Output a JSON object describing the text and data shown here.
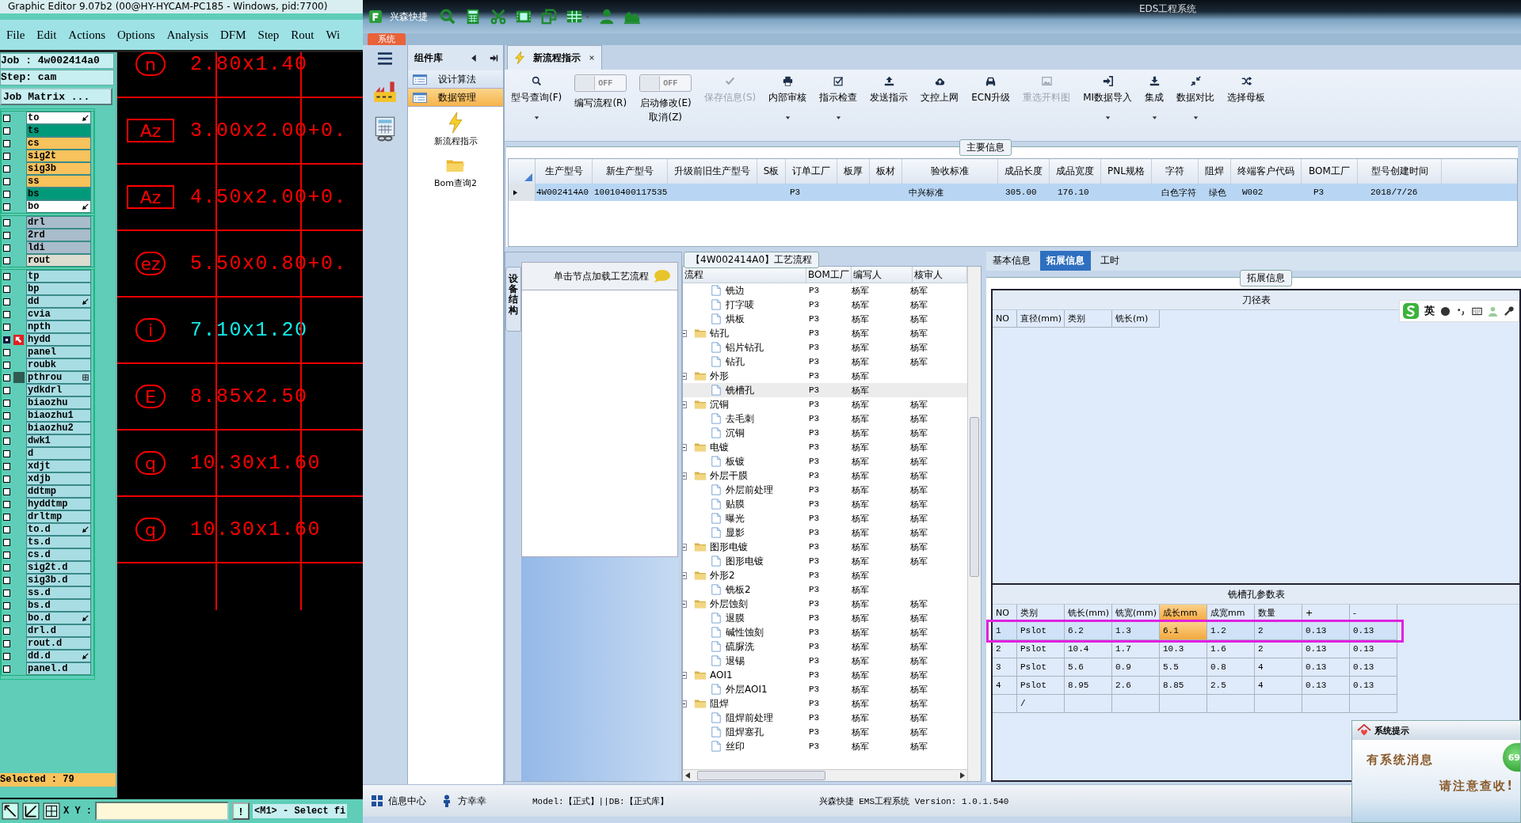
{
  "editor": {
    "title": "Graphic Editor 9.07b2 (00@HY-HYCAM-PC185 - Windows, pid:7700)",
    "menu": [
      "File",
      "Edit",
      "Actions",
      "Options",
      "Analysis",
      "DFM",
      "Step",
      "Rout",
      "Wi"
    ],
    "job": "Job : 4w002414a0",
    "step": "Step: cam",
    "matrix_button": "Job Matrix ...",
    "layer_groups": [
      [
        {
          "name": "to",
          "color": "#ffffff",
          "kind": "arrow",
          "checked": false
        },
        {
          "name": "ts",
          "color": "#009a7a",
          "kind": "plain",
          "checked": false
        },
        {
          "name": "cs",
          "color": "#f8c25c",
          "kind": "plain",
          "checked": false
        },
        {
          "name": "sig2t",
          "color": "#f8c25c",
          "kind": "plain",
          "checked": false
        },
        {
          "name": "sig3b",
          "color": "#f8c25c",
          "kind": "plain",
          "checked": false
        },
        {
          "name": "ss",
          "color": "#f8c25c",
          "kind": "plain",
          "checked": false
        },
        {
          "name": "bs",
          "color": "#009a7a",
          "kind": "plain",
          "checked": false
        },
        {
          "name": "bo",
          "color": "#ffffff",
          "kind": "arrow",
          "checked": false
        }
      ],
      [
        {
          "name": "drl",
          "color": "#a9bccb",
          "kind": "plain",
          "checked": false
        },
        {
          "name": "2rd",
          "color": "#a9bccb",
          "kind": "plain",
          "checked": false
        },
        {
          "name": "ldi",
          "color": "#a9bccb",
          "kind": "plain",
          "checked": false
        },
        {
          "name": "rout",
          "color": "#dcdccf",
          "kind": "plain",
          "checked": false
        }
      ],
      [
        {
          "name": "tp",
          "color": "#a8dde3",
          "kind": "plain",
          "checked": false
        },
        {
          "name": "bp",
          "color": "#a8dde3",
          "kind": "plain",
          "checked": false
        },
        {
          "name": "dd",
          "color": "#a8dde3",
          "kind": "arrow",
          "checked": false
        },
        {
          "name": "cvia",
          "color": "#a8dde3",
          "kind": "plain",
          "checked": false
        },
        {
          "name": "npth",
          "color": "#a8dde3",
          "kind": "plain",
          "checked": false
        },
        {
          "name": "hydd",
          "color": "#a8dde3",
          "kind": "work",
          "checked": true
        },
        {
          "name": "panel",
          "color": "#a8dde3",
          "kind": "plain",
          "checked": false
        },
        {
          "name": "roubk",
          "color": "#a8dde3",
          "kind": "plain",
          "checked": false
        },
        {
          "name": "pthrou",
          "color": "#a8dde3",
          "kind": "grid",
          "checked": false
        },
        {
          "name": "ydkdrl",
          "color": "#a8dde3",
          "kind": "plain",
          "checked": false
        },
        {
          "name": "biaozhu",
          "color": "#a8dde3",
          "kind": "plain",
          "checked": false
        },
        {
          "name": "biaozhu1",
          "color": "#a8dde3",
          "kind": "plain",
          "checked": false
        },
        {
          "name": "biaozhu2",
          "color": "#a8dde3",
          "kind": "plain",
          "checked": false
        },
        {
          "name": "dwk1",
          "color": "#a8dde3",
          "kind": "plain",
          "checked": false
        },
        {
          "name": "d",
          "color": "#a8dde3",
          "kind": "plain",
          "checked": false
        },
        {
          "name": "xdjt",
          "color": "#a8dde3",
          "kind": "plain",
          "checked": false
        },
        {
          "name": "xdjb",
          "color": "#a8dde3",
          "kind": "plain",
          "checked": false
        },
        {
          "name": "ddtmp",
          "color": "#a8dde3",
          "kind": "plain",
          "checked": false
        },
        {
          "name": "hyddtmp",
          "color": "#a8dde3",
          "kind": "plain",
          "checked": false
        },
        {
          "name": "drltmp",
          "color": "#a8dde3",
          "kind": "plain",
          "checked": false
        },
        {
          "name": "to.d",
          "color": "#a8dde3",
          "kind": "arrow",
          "checked": false
        },
        {
          "name": "ts.d",
          "color": "#a8dde3",
          "kind": "plain",
          "checked": false
        },
        {
          "name": "cs.d",
          "color": "#a8dde3",
          "kind": "plain",
          "checked": false
        },
        {
          "name": "sig2t.d",
          "color": "#a8dde3",
          "kind": "plain",
          "checked": false
        },
        {
          "name": "sig3b.d",
          "color": "#a8dde3",
          "kind": "plain",
          "checked": false
        },
        {
          "name": "ss.d",
          "color": "#a8dde3",
          "kind": "plain",
          "checked": false
        },
        {
          "name": "bs.d",
          "color": "#a8dde3",
          "kind": "plain",
          "checked": false
        },
        {
          "name": "bo.d",
          "color": "#a8dde3",
          "kind": "arrow",
          "checked": false
        },
        {
          "name": "drl.d",
          "color": "#a8dde3",
          "kind": "plain",
          "checked": false
        },
        {
          "name": "rout.d",
          "color": "#a8dde3",
          "kind": "plain",
          "checked": false
        },
        {
          "name": "dd.d",
          "color": "#a8dde3",
          "kind": "arrow",
          "checked": false
        },
        {
          "name": "panel.d",
          "color": "#a8dde3",
          "kind": "plain",
          "checked": false
        }
      ]
    ],
    "selected": "Selected : 79",
    "canvas_rows": [
      {
        "symbol": "n",
        "kind": "oval",
        "size": "2.80x1.40",
        "highlight": false
      },
      {
        "symbol": "Az",
        "kind": "rect",
        "size": "3.00x2.00+0.",
        "highlight": false
      },
      {
        "symbol": "Az",
        "kind": "rect",
        "size": "4.50x2.00+0.",
        "highlight": false
      },
      {
        "symbol": "ez",
        "kind": "oval",
        "size": "5.50x0.80+0.",
        "highlight": false
      },
      {
        "symbol": "i",
        "kind": "oval",
        "size": "7.10x1.20",
        "highlight": true
      },
      {
        "symbol": "E",
        "kind": "oval",
        "size": "8.85x2.50",
        "highlight": false
      },
      {
        "symbol": "q",
        "kind": "oval",
        "size": "10.30x1.60",
        "highlight": false
      },
      {
        "symbol": "q",
        "kind": "oval",
        "size": "10.30x1.60",
        "highlight": false
      }
    ],
    "xy_label": "X Y :",
    "alert_button": "!",
    "prompt": "<M1> - Select fi"
  },
  "app": {
    "title": "EDS工程系统",
    "brand": "兴森快捷",
    "system_tab": "系统",
    "component_panel": {
      "title": "组件库",
      "groups": [
        {
          "label": "设计算法",
          "selected": false
        },
        {
          "label": "数据管理",
          "selected": true
        }
      ],
      "items": [
        {
          "label": "新流程指示",
          "kind": "flash"
        },
        {
          "label": "Bom查询2",
          "kind": "folder"
        }
      ]
    },
    "doc_tab": "新流程指示",
    "toolbar": [
      {
        "kind": "button",
        "label": "型号查询(F)",
        "dropdown": true,
        "disabled": false
      },
      {
        "kind": "toggle",
        "toggle_text": "OFF",
        "label": "编写流程(R)",
        "on": false
      },
      {
        "kind": "toggle",
        "toggle_text": "OFF",
        "label": "启动修改(E)\n取消(Z)",
        "on": false
      },
      {
        "kind": "button",
        "label": "保存信息(S)",
        "dropdown": false,
        "disabled": true
      },
      {
        "kind": "button",
        "label": "内部审核",
        "dropdown": true,
        "disabled": false
      },
      {
        "kind": "button",
        "label": "指示检查",
        "dropdown": true,
        "disabled": false
      },
      {
        "kind": "button",
        "label": "发送指示",
        "dropdown": false,
        "disabled": false
      },
      {
        "kind": "button",
        "label": "文控上网",
        "dropdown": false,
        "disabled": false
      },
      {
        "kind": "button",
        "label": "ECN升级",
        "dropdown": false,
        "disabled": false
      },
      {
        "kind": "button",
        "label": "重选开料图",
        "dropdown": false,
        "disabled": true
      },
      {
        "kind": "button",
        "label": "MI数据导入",
        "dropdown": true,
        "disabled": false
      },
      {
        "kind": "button",
        "label": "集成",
        "dropdown": true,
        "disabled": false
      },
      {
        "kind": "button",
        "label": "数据对比",
        "dropdown": true,
        "disabled": false
      },
      {
        "kind": "button",
        "label": "选择母板",
        "dropdown": false,
        "disabled": false
      }
    ],
    "main_info": {
      "legend": "主要信息",
      "columns": [
        "生产型号",
        "新生产型号",
        "升级前旧生产型号",
        "S板",
        "订单工厂",
        "板厚",
        "板材",
        "验收标准",
        "成品长度",
        "成品宽度",
        "PNL规格",
        "字符",
        "阻焊",
        "终端客户代码",
        "BOM工厂",
        "型号创建时间"
      ],
      "rows": [
        {
          "selected": true,
          "cells": [
            "4W002414A0",
            "10010400117535",
            null,
            null,
            "P3",
            null,
            null,
            "中兴标准",
            "305.00",
            "176.10",
            null,
            "白色字符",
            "绿色",
            "W002",
            "P3",
            "2018/7/26"
          ]
        }
      ]
    },
    "flow_panel": {
      "side_tab": "设备结构",
      "hint": "单击节点加载工艺流程"
    },
    "process": {
      "title": "【4W002414A0】工艺流程",
      "columns": [
        "流程",
        "BOM工厂",
        "编写人",
        "核审人"
      ],
      "nodes": [
        {
          "children": [
            {
              "label": "铣边",
              "kind": "file",
              "bom": "P3",
              "writer": "杨军",
              "reviewer": "杨军",
              "selected": false
            },
            {
              "label": "打字唛",
              "kind": "file",
              "bom": "P3",
              "writer": "杨军",
              "reviewer": "杨军",
              "selected": false
            },
            {
              "label": "烘板",
              "kind": "file",
              "bom": "P3",
              "writer": "杨军",
              "reviewer": "杨军",
              "selected": false
            }
          ]
        },
        {
          "label": "钻孔",
          "kind": "folder",
          "expanded": true,
          "bom": "P3",
          "writer": "杨军",
          "reviewer": "杨军",
          "selected": false,
          "children": [
            {
              "label": "铝片钻孔",
              "kind": "file",
              "bom": "P3",
              "writer": "杨军",
              "reviewer": "杨军",
              "selected": false
            },
            {
              "label": "钻孔",
              "kind": "file",
              "bom": "P3",
              "writer": "杨军",
              "reviewer": "杨军",
              "selected": false
            }
          ]
        },
        {
          "label": "外形",
          "kind": "folder",
          "expanded": true,
          "bom": "P3",
          "writer": "杨军",
          "selected": false,
          "children": [
            {
              "label": "铣槽孔",
              "kind": "file",
              "bom": "P3",
              "writer": "杨军",
              "selected": true
            }
          ]
        },
        {
          "label": "沉铜",
          "kind": "folder",
          "expanded": true,
          "bom": "P3",
          "writer": "杨军",
          "reviewer": "杨军",
          "selected": false,
          "children": [
            {
              "label": "去毛刺",
              "kind": "file",
              "bom": "P3",
              "writer": "杨军",
              "reviewer": "杨军",
              "selected": false
            },
            {
              "label": "沉铜",
              "kind": "file",
              "bom": "P3",
              "writer": "杨军",
              "reviewer": "杨军",
              "selected": false
            }
          ]
        },
        {
          "label": "电镀",
          "kind": "folder",
          "expanded": true,
          "bom": "P3",
          "writer": "杨军",
          "reviewer": "杨军",
          "selected": false,
          "children": [
            {
              "label": "板镀",
              "kind": "file",
              "bom": "P3",
              "writer": "杨军",
              "reviewer": "杨军",
              "selected": false
            }
          ]
        },
        {
          "label": "外层干膜",
          "kind": "folder",
          "expanded": true,
          "bom": "P3",
          "writer": "杨军",
          "reviewer": "杨军",
          "selected": false,
          "children": [
            {
              "label": "外层前处理",
              "kind": "file",
              "bom": "P3",
              "writer": "杨军",
              "reviewer": "杨军",
              "selected": false
            },
            {
              "label": "贴膜",
              "kind": "file",
              "bom": "P3",
              "writer": "杨军",
              "reviewer": "杨军",
              "selected": false
            },
            {
              "label": "曝光",
              "kind": "file",
              "bom": "P3",
              "writer": "杨军",
              "reviewer": "杨军",
              "selected": false
            },
            {
              "label": "显影",
              "kind": "file",
              "bom": "P3",
              "writer": "杨军",
              "reviewer": "杨军",
              "selected": false
            }
          ]
        },
        {
          "label": "图形电镀",
          "kind": "folder",
          "expanded": true,
          "bom": "P3",
          "writer": "杨军",
          "reviewer": "杨军",
          "selected": false,
          "children": [
            {
              "label": "图形电镀",
              "kind": "file",
              "bom": "P3",
              "writer": "杨军",
              "reviewer": "杨军",
              "selected": false
            }
          ]
        },
        {
          "label": "外形2",
          "kind": "folder",
          "expanded": true,
          "bom": "P3",
          "writer": "杨军",
          "selected": false,
          "children": [
            {
              "label": "铣板2",
              "kind": "file",
              "bom": "P3",
              "writer": "杨军",
              "selected": false
            }
          ]
        },
        {
          "label": "外层蚀刻",
          "kind": "folder",
          "expanded": true,
          "bom": "P3",
          "writer": "杨军",
          "reviewer": "杨军",
          "selected": false,
          "children": [
            {
              "label": "退膜",
              "kind": "file",
              "bom": "P3",
              "writer": "杨军",
              "reviewer": "杨军",
              "selected": false
            },
            {
              "label": "碱性蚀刻",
              "kind": "file",
              "bom": "P3",
              "writer": "杨军",
              "reviewer": "杨军",
              "selected": false
            },
            {
              "label": "硫脲洗",
              "kind": "file",
              "bom": "P3",
              "writer": "杨军",
              "reviewer": "杨军",
              "selected": false
            },
            {
              "label": "退锡",
              "kind": "file",
              "bom": "P3",
              "writer": "杨军",
              "reviewer": "杨军",
              "selected": false
            }
          ]
        },
        {
          "label": "AOI1",
          "kind": "folder",
          "expanded": true,
          "bom": "P3",
          "writer": "杨军",
          "reviewer": "杨军",
          "selected": false,
          "children": [
            {
              "label": "外层AOI1",
              "kind": "file",
              "bom": "P3",
              "writer": "杨军",
              "reviewer": "杨军",
              "selected": false
            }
          ]
        },
        {
          "label": "阻焊",
          "kind": "folder",
          "expanded": true,
          "bom": "P3",
          "writer": "杨军",
          "reviewer": "杨军",
          "selected": false,
          "children": [
            {
              "label": "阻焊前处理",
              "kind": "file",
              "bom": "P3",
              "writer": "杨军",
              "reviewer": "杨军",
              "selected": false
            },
            {
              "label": "阻焊塞孔",
              "kind": "file",
              "bom": "P3",
              "writer": "杨军",
              "reviewer": "杨军",
              "selected": false
            },
            {
              "label": "丝印",
              "kind": "file",
              "bom": "P3",
              "writer": "杨军",
              "reviewer": "杨军",
              "selected": false
            }
          ]
        }
      ]
    },
    "detail": {
      "tabs": [
        {
          "label": "基本信息",
          "selected": false
        },
        {
          "label": "拓展信息",
          "selected": true
        },
        {
          "label": "工时",
          "selected": false
        }
      ],
      "legend": "拓展信息",
      "ime_bar": {
        "lang": "英"
      },
      "cutter_table": {
        "title": "刀径表",
        "columns": [
          "NO",
          "直径(mm)",
          "类别",
          "铣长(m)"
        ]
      },
      "slot_table": {
        "title": "铣槽孔参数表",
        "highlight_frame": true,
        "columns": [
          {
            "label": "NO",
            "selected": false
          },
          {
            "label": "类别",
            "selected": false
          },
          {
            "label": "铣长(mm)",
            "selected": false
          },
          {
            "label": "铣宽(mm)",
            "selected": false
          },
          {
            "label": "成长mm",
            "selected": true
          },
          {
            "label": "成宽mm",
            "selected": false
          },
          {
            "label": "数量",
            "selected": false
          },
          {
            "label": "+",
            "selected": false
          },
          {
            "label": "-",
            "selected": false
          }
        ],
        "rows": [
          {
            "selected": true,
            "cells": [
              "1",
              "Pslot",
              "6.2",
              "1.3",
              "6.1",
              "1.2",
              "2",
              "0.13",
              "0.13"
            ]
          },
          {
            "selected": false,
            "cells": [
              "2",
              "Pslot",
              "10.4",
              "1.7",
              "10.3",
              "1.6",
              "2",
              "0.13",
              "0.13"
            ]
          },
          {
            "selected": false,
            "cells": [
              "3",
              "Pslot",
              "5.6",
              "0.9",
              "5.5",
              "0.8",
              "4",
              "0.13",
              "0.13"
            ]
          },
          {
            "selected": false,
            "cells": [
              "4",
              "Pslot",
              "8.95",
              "2.6",
              "8.85",
              "2.5",
              "4",
              "0.13",
              "0.13"
            ]
          },
          {
            "selected": false,
            "cells": [
              null,
              "/",
              null,
              null,
              null,
              null,
              null,
              null,
              null
            ]
          }
        ]
      }
    },
    "status": {
      "items": [
        "信息中心",
        "方幸幸"
      ],
      "model": "Model:【正式】||DB:【正式库】",
      "version": "兴森快捷 EMS工程系统 Version: 1.0.1.540"
    },
    "popup": {
      "title": "系统提示",
      "line1": "有系统消息",
      "line2": "请注意查收!",
      "badge": "69"
    }
  }
}
